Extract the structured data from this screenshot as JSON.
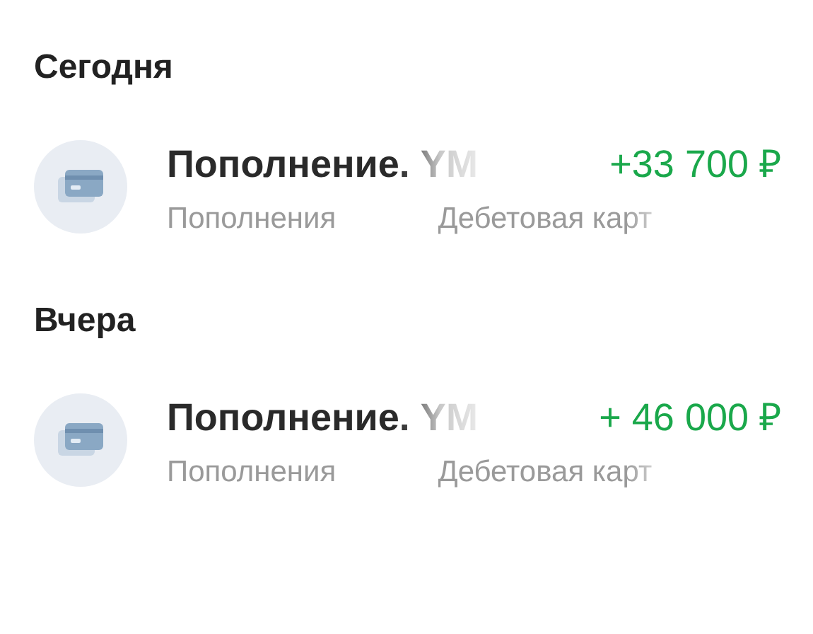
{
  "sections": [
    {
      "heading": "Сегодня",
      "operations": [
        {
          "title": "Пополнение. YM",
          "amount": "+33 700 ₽",
          "category": "Пополнения",
          "account": "Дебетовая карт"
        }
      ]
    },
    {
      "heading": "Вчера",
      "operations": [
        {
          "title": "Пополнение. YM",
          "amount": "+ 46 000 ₽",
          "category": "Пополнения",
          "account": "Дебетовая карт"
        }
      ]
    }
  ]
}
